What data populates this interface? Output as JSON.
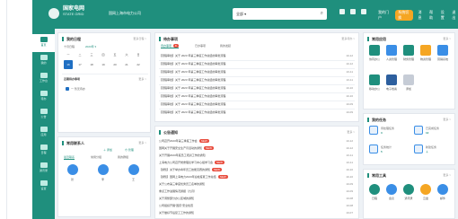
{
  "brand": {
    "name": "国家电网",
    "sub": "STATE GRID",
    "org": "国网上海市电力公司"
  },
  "search": {
    "select": "全部 ▾",
    "icon": "search-icon"
  },
  "topbar": {
    "right": [
      "我的门户",
      "系统切换",
      "消息",
      "帮助",
      "设置",
      "退出"
    ],
    "pill": "系统切换"
  },
  "sidebar": {
    "items": [
      "首页",
      "我的",
      "工作台",
      "待办",
      "公告",
      "应用",
      "日程",
      "通讯录",
      "设置"
    ]
  },
  "schedule": {
    "title": "我的日程",
    "more": "更多日程 >",
    "month": "十月日程",
    "year": "2023年 ▾",
    "weekdays": [
      "一",
      "二",
      "三",
      "四",
      "五",
      "六",
      "日"
    ],
    "days": [
      "16",
      "17",
      "18",
      "19",
      "20",
      "21",
      "22"
    ],
    "today_index": 0,
    "section": "近期待办事项",
    "section_more": "更多 >",
    "items": [
      "一 暂无待办"
    ]
  },
  "contacts": {
    "title": "常用联系人",
    "more": "更多 >",
    "tabs": [
      "最近联系",
      "常用分组",
      "我的群组"
    ],
    "actions": [
      "＋ 添加",
      "⊖ 管理"
    ],
    "names": [
      "张",
      "李",
      "王"
    ]
  },
  "todo": {
    "title": "待办事项",
    "more": "更多待办 >",
    "tabs": [
      "待办事项",
      "已办事项",
      "我的发起"
    ],
    "count": "8",
    "rows": [
      {
        "t": "【流程审批】关于 2023 年第三季度工作总结的审批流程",
        "d": "10-12"
      },
      {
        "t": "【流程审批】关于 2023 年第三季度工作总结的审批流程",
        "d": "10-12"
      },
      {
        "t": "【流程审批】关于 2023 年第三季度工作总结的审批流程",
        "d": "10-11"
      },
      {
        "t": "【流程审批】关于 2023 年第三季度工作总结的审批流程",
        "d": "10-11"
      },
      {
        "t": "【流程审批】关于 2023 年第三季度工作总结的审批流程",
        "d": "10-10"
      },
      {
        "t": "【流程审批】关于 2023 年第三季度工作总结的审批流程",
        "d": "10-10"
      },
      {
        "t": "【流程审批】关于 2023 年第三季度工作总结的审批流程",
        "d": "10-09"
      },
      {
        "t": "【流程审批】关于 2023 年第三季度工作总结的审批流程",
        "d": "10-09"
      }
    ]
  },
  "notice": {
    "title": "公告通知",
    "more": "更多 >",
    "badge": "NEW",
    "rows": [
      {
        "t": "公司召开2023年第三季度工作会",
        "d": "10-12",
        "new": true
      },
      {
        "t": "国网关于开展安全生产月活动的通知",
        "d": "10-12",
        "new": true
      },
      {
        "t": "关于开展2023年度员工培训工作的通知",
        "d": "10-11",
        "new": false
      },
      {
        "t": "上海电力公司召开党委理论学习中心组学习会",
        "d": "10-11",
        "new": true
      },
      {
        "t": "【通知】关于举办青年员工技能竞赛的通知",
        "d": "10-10",
        "new": true
      },
      {
        "t": "【通知】国网上海电力2023年迎峰度夏工作总结",
        "d": "10-10",
        "new": true
      },
      {
        "t": "关于公布第三季度优秀员工名单的通知",
        "d": "10-09",
        "new": false
      },
      {
        "t": "重点工作进展情况通报（九月）",
        "d": "10-09",
        "new": false
      },
      {
        "t": "关于调整部分办公区域的通知",
        "d": "10-08",
        "new": false
      },
      {
        "t": "公司组织开展\"国庆\"安全检查",
        "d": "10-08",
        "new": false
      },
      {
        "t": "关于做好节后复工工作的通知",
        "d": "10-07",
        "new": false
      }
    ]
  },
  "apps": {
    "title": "常用应用",
    "more": "更多 >",
    "items": [
      {
        "n": "协同办公",
        "c": "#1f8f7d"
      },
      {
        "n": "人资管理",
        "c": "#3a8ee6"
      },
      {
        "n": "财务管理",
        "c": "#1f8f7d"
      },
      {
        "n": "物资管理",
        "c": "#f5a623"
      },
      {
        "n": "营销系统",
        "c": "#3a8ee6"
      },
      {
        "n": "移动办公",
        "c": "#1f8f7d"
      },
      {
        "n": "电子档案",
        "c": "#2d5f9e"
      },
      {
        "n": "添加",
        "c": "#c6ccd6"
      }
    ]
  },
  "tasks": {
    "title": "我的任务",
    "more": "更多 >",
    "items": [
      {
        "n": "待处理任务",
        "v": "3"
      },
      {
        "n": "已完成任务",
        "v": "12"
      },
      {
        "n": "任务统计",
        "v": "5"
      },
      {
        "n": "新建任务",
        "v": "＋"
      }
    ]
  },
  "tools": {
    "title": "常用工具",
    "more": "更多 >",
    "items": [
      {
        "n": "日程",
        "c": "#1f8f7d"
      },
      {
        "n": "会议",
        "c": "#3a8ee6"
      },
      {
        "n": "通讯录",
        "c": "#1f8f7d"
      },
      {
        "n": "云盘",
        "c": "#f5a623"
      },
      {
        "n": "邮件",
        "c": "#3a8ee6"
      }
    ]
  }
}
